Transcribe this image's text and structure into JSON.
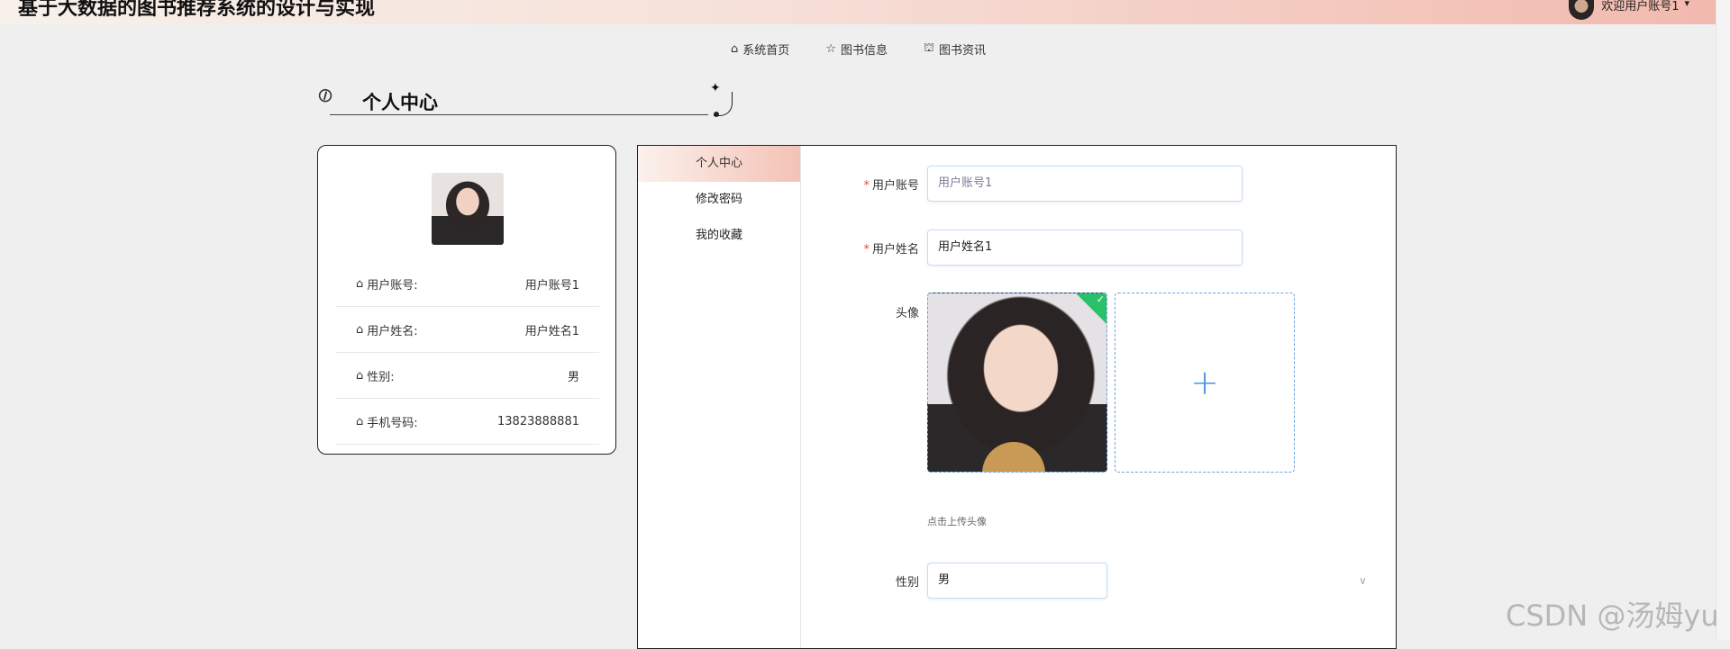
{
  "header": {
    "title": "基于大数据的图书推荐系统的设计与实现",
    "welcome": "欢迎用户账号1",
    "caret": "▾"
  },
  "nav": [
    {
      "icon": "home-icon",
      "glyph": "⌂",
      "label": "系统首页"
    },
    {
      "icon": "star-icon",
      "glyph": "☆",
      "label": "图书信息"
    },
    {
      "icon": "bag-icon",
      "glyph": "⛫",
      "label": "图书资讯"
    }
  ],
  "page": {
    "title": "个人中心"
  },
  "profile": {
    "rows": [
      {
        "label": "用户账号:",
        "value": "用户账号1"
      },
      {
        "label": "用户姓名:",
        "value": "用户姓名1"
      },
      {
        "label": "性别:",
        "value": "男"
      },
      {
        "label": "手机号码:",
        "value": "13823888881"
      }
    ],
    "row_icon": "⌂"
  },
  "menu": [
    {
      "label": "个人中心",
      "active": true
    },
    {
      "label": "修改密码",
      "active": false
    },
    {
      "label": "我的收藏",
      "active": false
    }
  ],
  "form": {
    "account_label": "用户账号",
    "account_placeholder": "用户账号1",
    "name_label": "用户姓名",
    "name_value": "用户姓名1",
    "avatar_label": "头像",
    "upload_plus": "+",
    "upload_hint": "点击上传头像",
    "gender_label": "性别",
    "gender_value": "男",
    "select_arrow": "∨",
    "required_mark": "*",
    "check_mark": "✓"
  },
  "watermark": "CSDN @汤姆yu"
}
